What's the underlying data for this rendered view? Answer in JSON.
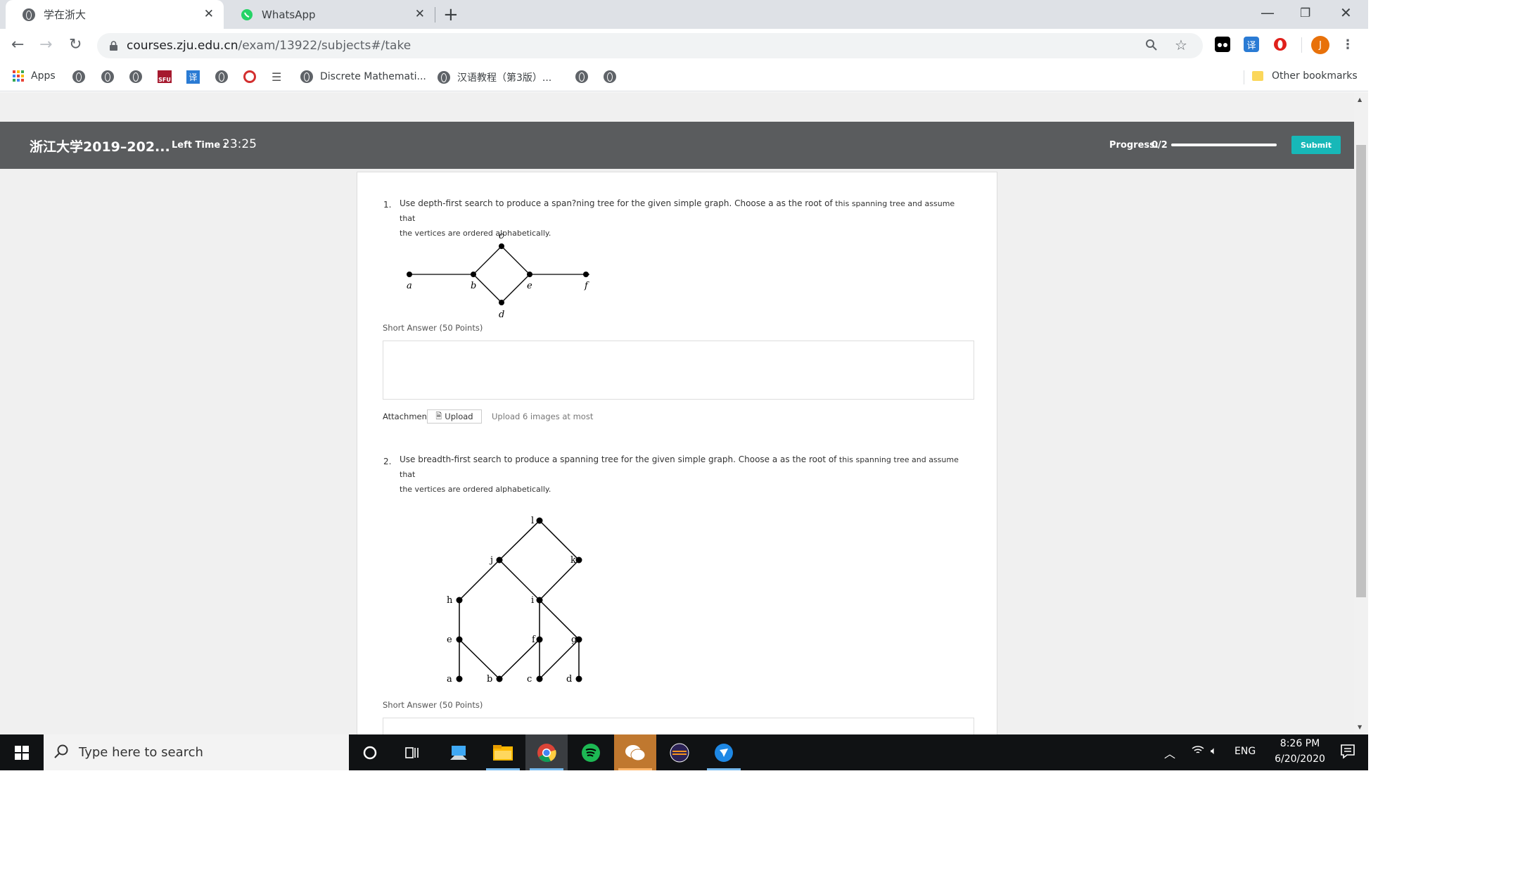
{
  "browser": {
    "tabs": [
      {
        "title": "学在浙大",
        "active": true
      },
      {
        "title": "WhatsApp",
        "active": false
      }
    ],
    "new_tab": "+",
    "url_host": "courses.zju.edu.cn",
    "url_path": "/exam/13922/subjects#/take",
    "bookmarks": {
      "apps_label": "Apps",
      "item_discrete": "Discrete Mathemati...",
      "item_hanyu": "汉语教程（第3版）...",
      "other_label": "Other bookmarks"
    },
    "profile_initial": "J",
    "ext_translate": "译",
    "sfu_label": "SFU"
  },
  "exam": {
    "title": "浙江大学2019–202...",
    "left_time_label": "Left Time :",
    "left_time_value": "23:25",
    "progress_label": "Progress:",
    "progress_value": "0/2",
    "progress_fraction": 0,
    "submit_label": "Submit",
    "questions": [
      {
        "number": "1.",
        "text_main": "Use depth-first search to produce a span?ning tree for the given simple graph. Choose a as the root of",
        "text_small": " this spanning tree and assume that",
        "text_line2": "the vertices are ordered  alphabetically.",
        "short_answer_label": "Short Answer (50 Points)",
        "graph_labels": [
          "a",
          "b",
          "c",
          "d",
          "e",
          "f"
        ]
      },
      {
        "number": "2.",
        "text_main": "Use breadth-first search to produce a spanning tree for the given simple graph. Choose a as the root of",
        "text_small": " this spanning tree and assume that",
        "text_line2": "the vertices are ordered alphabetically.",
        "short_answer_label": "Short Answer (50 Points)",
        "graph_labels": [
          "a",
          "b",
          "c",
          "d",
          "e",
          "f",
          "g",
          "h",
          "i",
          "j",
          "k",
          "l"
        ]
      }
    ],
    "attachment_label": "Attachment",
    "upload_label": "Upload",
    "upload_note": "Upload 6 images at most"
  },
  "taskbar": {
    "search_placeholder": "Type here to search",
    "language": "ENG",
    "time": "8:26 PM",
    "date": "6/20/2020"
  }
}
